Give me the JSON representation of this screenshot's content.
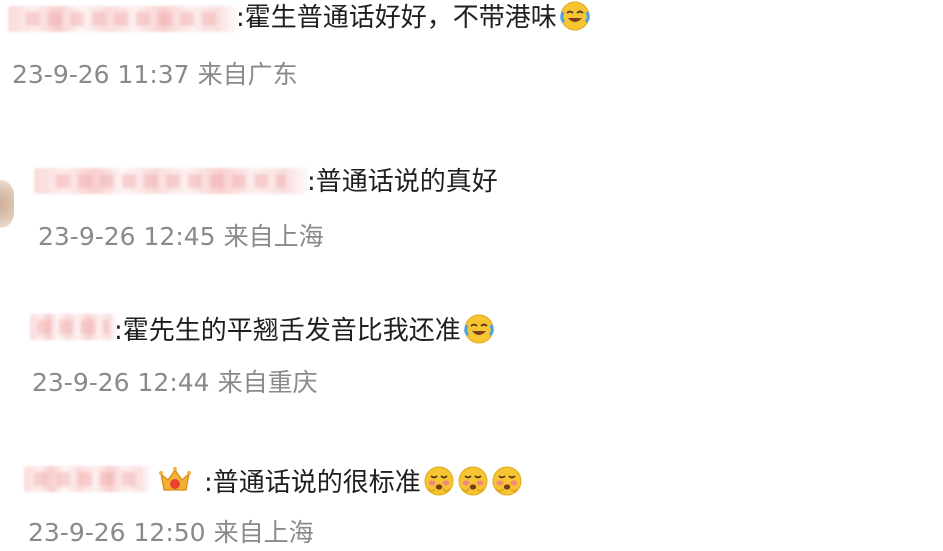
{
  "comments": [
    {
      "text": ":霍生普通话好好，不带港味",
      "emoji": [
        "laugh-cry-icon"
      ],
      "time": "23-9-26 11:37",
      "location": "来自广东"
    },
    {
      "text": ":普通话说的真好",
      "emoji": [],
      "time": "23-9-26 12:45",
      "location": "来自上海"
    },
    {
      "text": ":霍先生的平翘舌发音比我还准",
      "emoji": [
        "laugh-cry-icon"
      ],
      "time": "23-9-26 12:44",
      "location": "来自重庆"
    },
    {
      "text": ":普通话说的很标准",
      "emoji": [
        "blushing-face-icon",
        "blushing-face-icon",
        "blushing-face-icon"
      ],
      "time": "23-9-26 12:50",
      "location": "来自上海",
      "badge_icon": "crown-badge-icon"
    }
  ],
  "colors": {
    "text": "#1f1f1f",
    "meta": "#8a8a8a",
    "blur": "#f4b4b4",
    "emoji_yellow": "#f7c531",
    "tear_blue": "#4aa3e8"
  }
}
